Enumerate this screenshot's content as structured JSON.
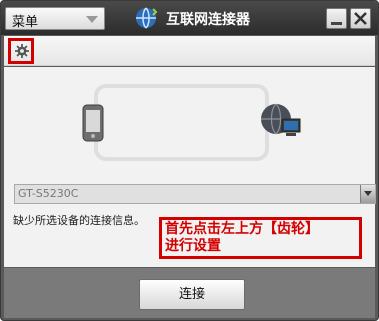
{
  "titlebar": {
    "menu_label": "菜单",
    "title": "互联网连接器"
  },
  "toolbar": {
    "settings_icon": "gear-icon"
  },
  "main": {
    "device_select_value": "GT-S5230C",
    "status_text": "缺少所选设备的连接信息。",
    "hint_line1": "首先点击左上方【齿轮】",
    "hint_line2": "进行设置"
  },
  "footer": {
    "connect_label": "连接"
  },
  "colors": {
    "highlight_red": "#d40000",
    "titlebar_dark": "#2c2c2c",
    "bottom_gray": "#7a7a7a"
  }
}
